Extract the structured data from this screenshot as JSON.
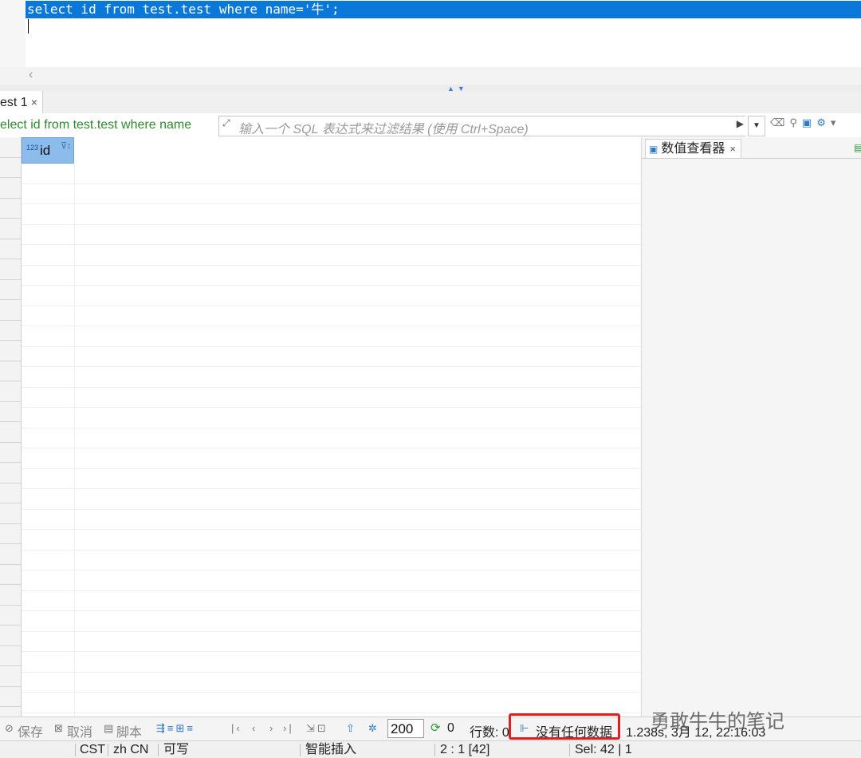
{
  "editor": {
    "sql": "select id from test.test where name='牛';"
  },
  "results_tab": {
    "label": "est 1",
    "close": "×"
  },
  "filter": {
    "sql_text": "elect id from test.test where name",
    "placeholder": "输入一个 SQL 表达式来过滤结果 (使用 Ctrl+Space)"
  },
  "grid": {
    "columns": [
      {
        "type_badge": "123",
        "name": "id"
      }
    ],
    "rows": []
  },
  "value_viewer": {
    "title": "数值查看器",
    "close": "×"
  },
  "toolbar": {
    "save": "保存",
    "cancel": "取消",
    "script": "脚本",
    "page_size": "200",
    "refresh_count": "0",
    "row_count_label": "行数: 0",
    "no_data": "没有任何数据",
    "timing": "1.238s, 3月 12, 22:16:03"
  },
  "statusbar": {
    "timezone": "CST",
    "locale": "zh CN",
    "mode": "可写",
    "insert_mode": "智能插入",
    "position": "2 : 1 [42]",
    "selection": "Sel: 42 | 1"
  },
  "watermark": "勇敢牛牛的笔记",
  "colors": {
    "selection": "#0a78d8",
    "column_header": "#8bbcec",
    "highlight_box": "#e02020",
    "filter_sql": "#2f8a2f"
  }
}
